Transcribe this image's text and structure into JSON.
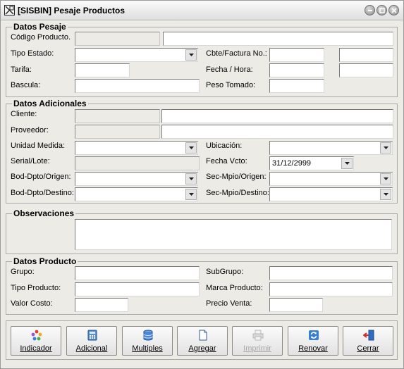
{
  "window": {
    "title": "[SISBIN] Pesaje Productos"
  },
  "datos_pesaje": {
    "title": "Datos Pesaje",
    "codigo_label": "Código Producto.",
    "tipo_estado_label": "Tipo Estado:",
    "tarifa_label": "Tarifa:",
    "bascula_label": "Bascula:",
    "cbte_label": "Cbte/Factura No.:",
    "fecha_hora_label": "Fecha / Hora:",
    "peso_label": "Peso Tomado:"
  },
  "datos_adicionales": {
    "title": "Datos Adicionales",
    "cliente_label": "Cliente:",
    "proveedor_label": "Proveedor:",
    "unidad_label": "Unidad Medida:",
    "serial_label": "Serial/Lote:",
    "bod_origen_label": "Bod-Dpto/Origen:",
    "bod_destino_label": "Bod-Dpto/Destino:",
    "ubicacion_label": "Ubicación:",
    "fecha_vcto_label": "Fecha Vcto:",
    "fecha_vcto_value": "31/12/2999",
    "sec_origen_label": "Sec-Mpio/Origen:",
    "sec_destino_label": "Sec-Mpio/Destino:"
  },
  "observaciones": {
    "title": "Observaciones"
  },
  "datos_producto": {
    "title": "Datos Producto",
    "grupo_label": "Grupo:",
    "tipo_producto_label": "Tipo Producto:",
    "valor_costo_label": "Valor Costo:",
    "subgrupo_label": "SubGrupo:",
    "marca_label": "Marca Producto:",
    "precio_venta_label": "Precio Venta:"
  },
  "buttons": {
    "indicador": "Indicador",
    "adicional": "Adicional",
    "multiples": "Multiples",
    "agregar": "Agregar",
    "imprimir": "Imprimir",
    "renovar": "Renovar",
    "cerrar": "Cerrar"
  },
  "icons": {
    "indicador": "colored-dots-icon",
    "adicional": "calculator-icon",
    "multiples": "database-icon",
    "agregar": "blank-page-icon",
    "imprimir": "printer-icon",
    "renovar": "refresh-icon",
    "cerrar": "exit-door-icon"
  }
}
